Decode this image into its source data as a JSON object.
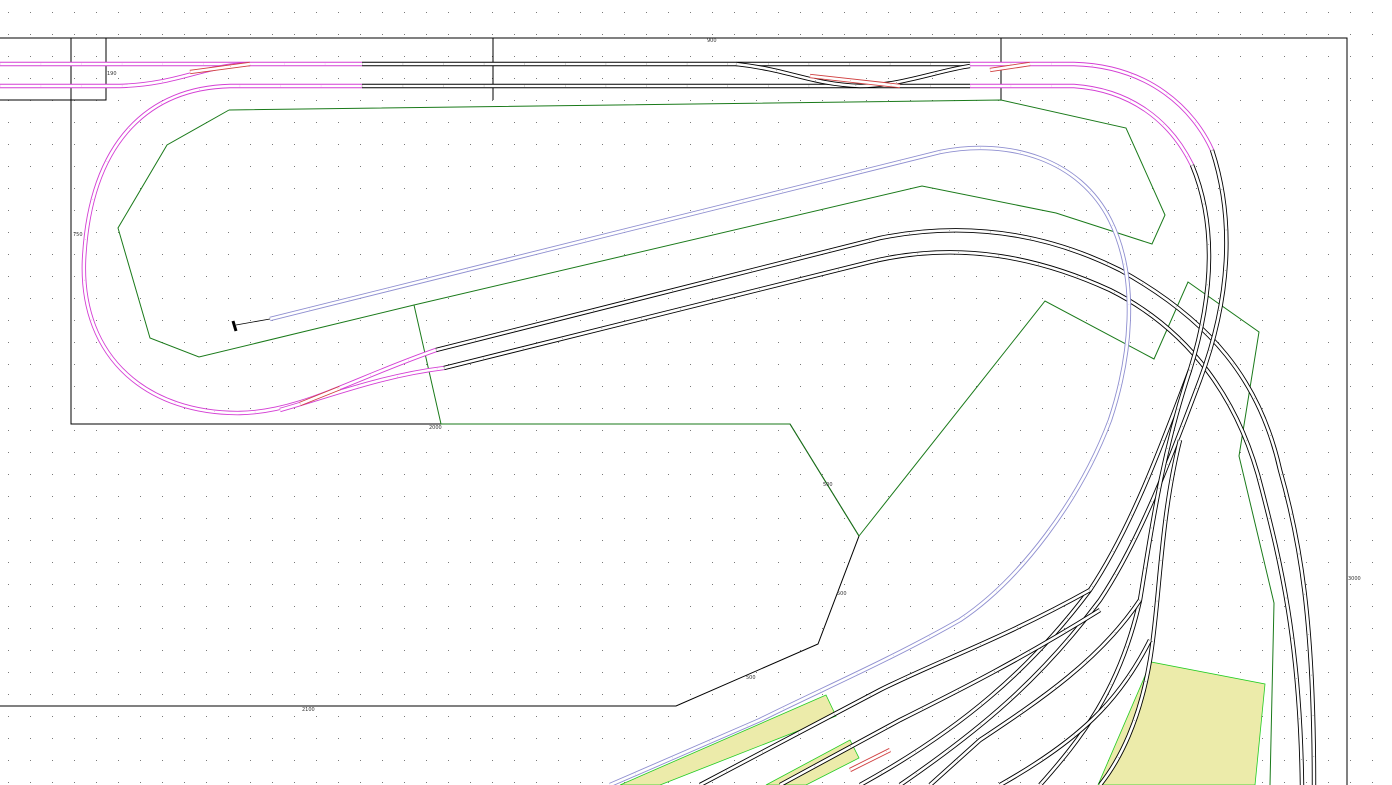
{
  "colors": {
    "background": "#ffffff",
    "grid_dot": "#555555",
    "baseboard": "#000000",
    "contour": "#1a7a1a",
    "helix_track": "#d43fd4",
    "main_track": "#000000",
    "branch_track": "#8f8fd0",
    "turnout_frog": "#d04040",
    "platform_fill": "#ecebaa",
    "platform_edge": "#22cc22"
  },
  "dimensions": {
    "top_width": "900",
    "left_height": "750",
    "inner_bottom": "2000",
    "lower_bottom": "2100",
    "right_height": "3000",
    "corner_upper": "190",
    "diag_a": "500",
    "diag_b": "500",
    "diag_c": "500"
  },
  "icons": {
    "buffer_stop": "buffer-stop-icon"
  }
}
